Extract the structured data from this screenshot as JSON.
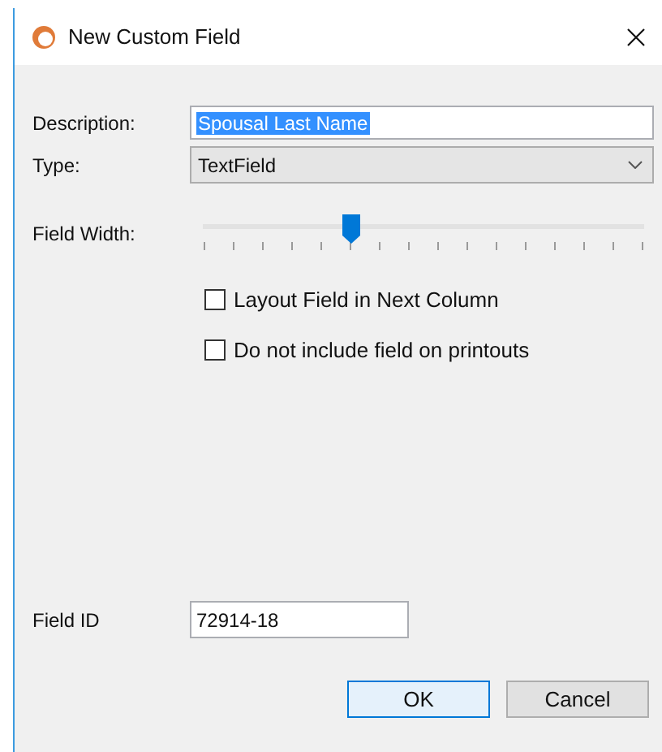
{
  "window": {
    "title": "New Custom Field"
  },
  "description": {
    "label": "Description:",
    "value": "Spousal Last Name",
    "selected": true
  },
  "type": {
    "label": "Type:",
    "value": "TextField"
  },
  "field_width": {
    "label": "Field Width:",
    "level": 0.333
  },
  "options": [
    {
      "label": "Layout Field in Next Column",
      "checked": false
    },
    {
      "label": "Do not include field on printouts",
      "checked": false
    }
  ],
  "field_id": {
    "label": "Field ID",
    "value": "72914-18"
  },
  "buttons": [
    {
      "label": "OK",
      "default": true
    },
    {
      "label": "Cancel",
      "default": false
    }
  ]
}
